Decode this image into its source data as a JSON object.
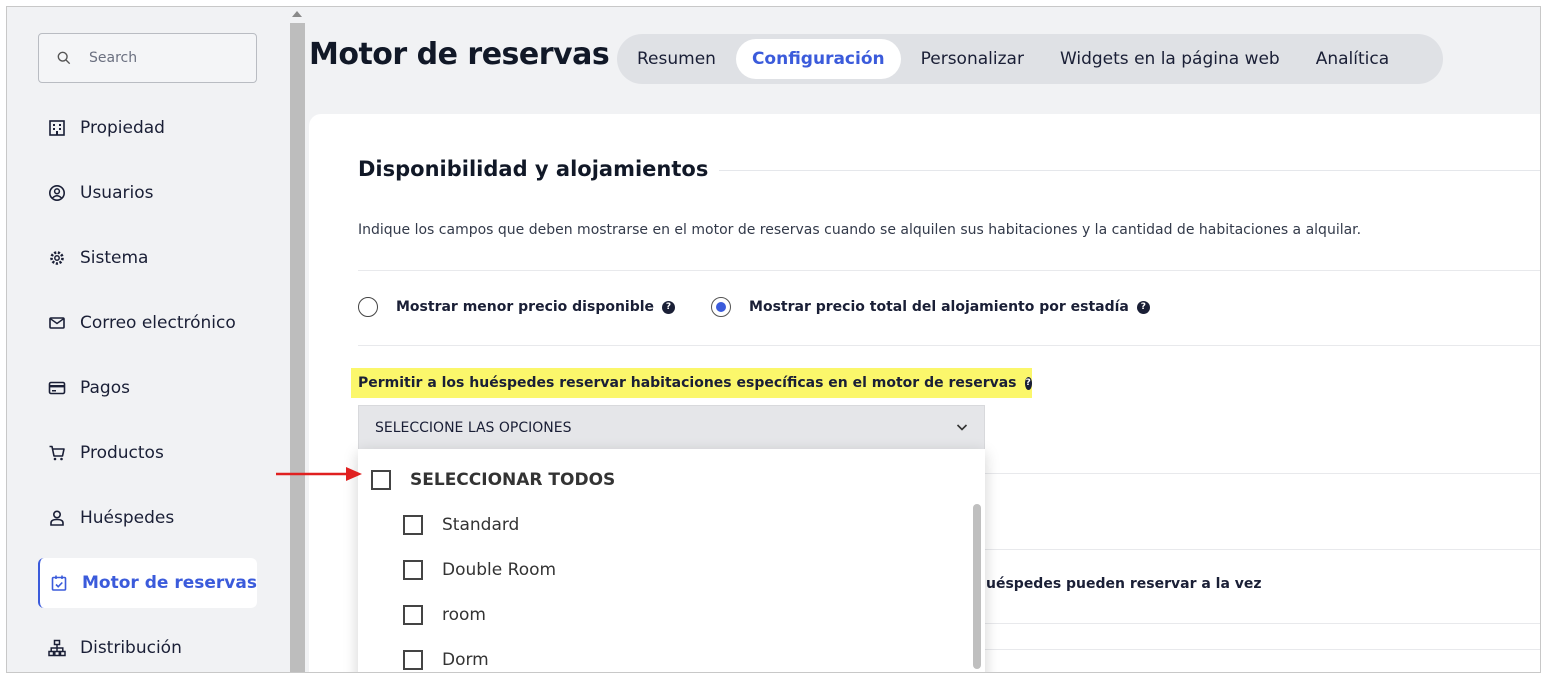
{
  "sidebar": {
    "search": {
      "placeholder": "Search"
    },
    "items": [
      {
        "label": "Propiedad",
        "icon": "building-icon"
      },
      {
        "label": "Usuarios",
        "icon": "user-circle-icon"
      },
      {
        "label": "Sistema",
        "icon": "gear-icon"
      },
      {
        "label": "Correo electrónico",
        "icon": "mail-icon"
      },
      {
        "label": "Pagos",
        "icon": "credit-card-icon"
      },
      {
        "label": "Productos",
        "icon": "cart-icon"
      },
      {
        "label": "Huéspedes",
        "icon": "person-icon"
      },
      {
        "label": "Motor de reservas",
        "icon": "calendar-check-icon",
        "active": true
      },
      {
        "label": "Distribución",
        "icon": "sitemap-icon"
      }
    ]
  },
  "header": {
    "title": "Motor de reservas",
    "tabs": [
      {
        "label": "Resumen"
      },
      {
        "label": "Configuración",
        "active": true
      },
      {
        "label": "Personalizar"
      },
      {
        "label": "Widgets en la página web"
      },
      {
        "label": "Analítica"
      }
    ]
  },
  "content": {
    "section_title": "Disponibilidad y alojamientos",
    "description": "Indique los campos que deben mostrarse en el motor de reservas cuando se alquilen sus habitaciones y la cantidad de habitaciones a alquilar.",
    "radio_options": [
      {
        "label": "Mostrar menor precio disponible",
        "checked": false
      },
      {
        "label": "Mostrar precio total del alojamiento por estadía",
        "checked": true
      }
    ],
    "highlight_label": "Permitir a los huéspedes reservar habitaciones específicas en el motor de reservas",
    "select": {
      "placeholder": "SELECCIONE LAS OPCIONES",
      "select_all": "SELECCIONAR TODOS",
      "options": [
        "Standard",
        "Double Room",
        "room",
        "Dorm"
      ]
    },
    "partial_text": "uéspedes pueden reservar a la vez"
  },
  "colors": {
    "accent": "#3b5bdb",
    "highlight": "#fbf76b",
    "annotation_arrow": "#e02020"
  }
}
